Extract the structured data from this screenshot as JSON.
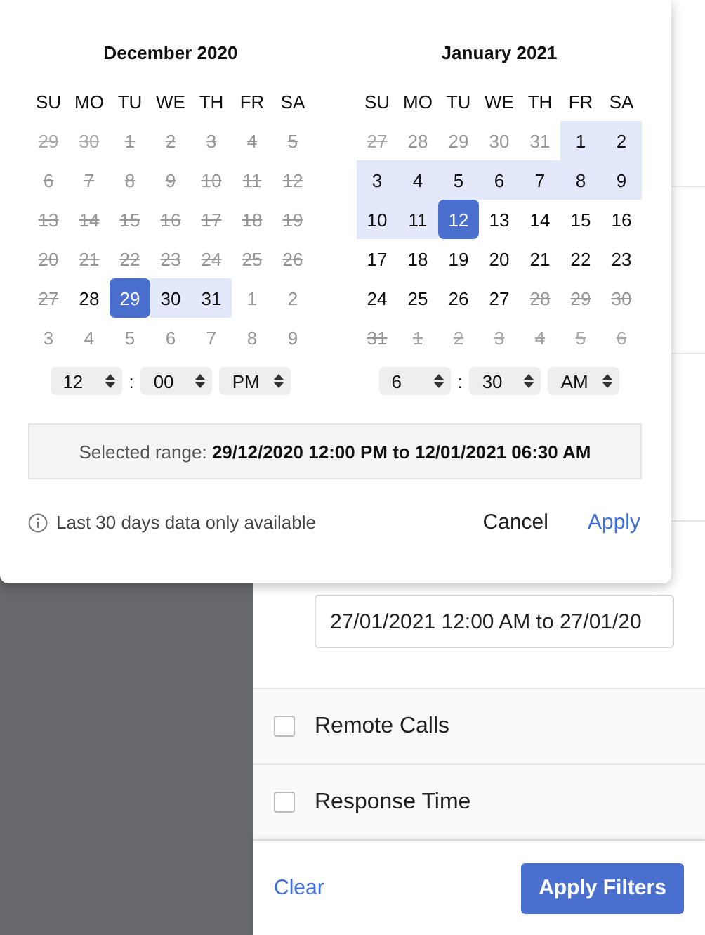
{
  "popup": {
    "months": [
      {
        "title": "December 2020",
        "weekdays": [
          "SU",
          "MO",
          "TU",
          "WE",
          "TH",
          "FR",
          "SA"
        ],
        "weeks": [
          [
            {
              "d": "29",
              "disabled": true,
              "outside": true,
              "in_range": false,
              "selected": false
            },
            {
              "d": "30",
              "disabled": true,
              "outside": true,
              "in_range": false,
              "selected": false
            },
            {
              "d": "1",
              "disabled": true,
              "outside": false,
              "in_range": false,
              "selected": false
            },
            {
              "d": "2",
              "disabled": true,
              "outside": false,
              "in_range": false,
              "selected": false
            },
            {
              "d": "3",
              "disabled": true,
              "outside": false,
              "in_range": false,
              "selected": false
            },
            {
              "d": "4",
              "disabled": true,
              "outside": false,
              "in_range": false,
              "selected": false
            },
            {
              "d": "5",
              "disabled": true,
              "outside": false,
              "in_range": false,
              "selected": false
            }
          ],
          [
            {
              "d": "6",
              "disabled": true,
              "outside": false,
              "in_range": false,
              "selected": false
            },
            {
              "d": "7",
              "disabled": true,
              "outside": false,
              "in_range": false,
              "selected": false
            },
            {
              "d": "8",
              "disabled": true,
              "outside": false,
              "in_range": false,
              "selected": false
            },
            {
              "d": "9",
              "disabled": true,
              "outside": false,
              "in_range": false,
              "selected": false
            },
            {
              "d": "10",
              "disabled": true,
              "outside": false,
              "in_range": false,
              "selected": false
            },
            {
              "d": "11",
              "disabled": true,
              "outside": false,
              "in_range": false,
              "selected": false
            },
            {
              "d": "12",
              "disabled": true,
              "outside": false,
              "in_range": false,
              "selected": false
            }
          ],
          [
            {
              "d": "13",
              "disabled": true,
              "outside": false,
              "in_range": false,
              "selected": false
            },
            {
              "d": "14",
              "disabled": true,
              "outside": false,
              "in_range": false,
              "selected": false
            },
            {
              "d": "15",
              "disabled": true,
              "outside": false,
              "in_range": false,
              "selected": false
            },
            {
              "d": "16",
              "disabled": true,
              "outside": false,
              "in_range": false,
              "selected": false
            },
            {
              "d": "17",
              "disabled": true,
              "outside": false,
              "in_range": false,
              "selected": false
            },
            {
              "d": "18",
              "disabled": true,
              "outside": false,
              "in_range": false,
              "selected": false
            },
            {
              "d": "19",
              "disabled": true,
              "outside": false,
              "in_range": false,
              "selected": false
            }
          ],
          [
            {
              "d": "20",
              "disabled": true,
              "outside": false,
              "in_range": false,
              "selected": false
            },
            {
              "d": "21",
              "disabled": true,
              "outside": false,
              "in_range": false,
              "selected": false
            },
            {
              "d": "22",
              "disabled": true,
              "outside": false,
              "in_range": false,
              "selected": false
            },
            {
              "d": "23",
              "disabled": true,
              "outside": false,
              "in_range": false,
              "selected": false
            },
            {
              "d": "24",
              "disabled": true,
              "outside": false,
              "in_range": false,
              "selected": false
            },
            {
              "d": "25",
              "disabled": true,
              "outside": false,
              "in_range": false,
              "selected": false
            },
            {
              "d": "26",
              "disabled": true,
              "outside": false,
              "in_range": false,
              "selected": false
            }
          ],
          [
            {
              "d": "27",
              "disabled": true,
              "outside": false,
              "in_range": false,
              "selected": false
            },
            {
              "d": "28",
              "disabled": false,
              "outside": false,
              "in_range": false,
              "selected": false
            },
            {
              "d": "29",
              "disabled": false,
              "outside": false,
              "in_range": false,
              "selected": true
            },
            {
              "d": "30",
              "disabled": false,
              "outside": false,
              "in_range": true,
              "selected": false
            },
            {
              "d": "31",
              "disabled": false,
              "outside": false,
              "in_range": true,
              "selected": false
            },
            {
              "d": "1",
              "disabled": false,
              "outside": true,
              "in_range": false,
              "selected": false
            },
            {
              "d": "2",
              "disabled": false,
              "outside": true,
              "in_range": false,
              "selected": false
            }
          ],
          [
            {
              "d": "3",
              "disabled": false,
              "outside": true,
              "in_range": false,
              "selected": false
            },
            {
              "d": "4",
              "disabled": false,
              "outside": true,
              "in_range": false,
              "selected": false
            },
            {
              "d": "5",
              "disabled": false,
              "outside": true,
              "in_range": false,
              "selected": false
            },
            {
              "d": "6",
              "disabled": false,
              "outside": true,
              "in_range": false,
              "selected": false
            },
            {
              "d": "7",
              "disabled": false,
              "outside": true,
              "in_range": false,
              "selected": false
            },
            {
              "d": "8",
              "disabled": false,
              "outside": true,
              "in_range": false,
              "selected": false
            },
            {
              "d": "9",
              "disabled": false,
              "outside": true,
              "in_range": false,
              "selected": false
            }
          ]
        ],
        "time": {
          "hour": "12",
          "separator": ":",
          "minute": "00",
          "meridiem": "PM"
        }
      },
      {
        "title": "January 2021",
        "weekdays": [
          "SU",
          "MO",
          "TU",
          "WE",
          "TH",
          "FR",
          "SA"
        ],
        "weeks": [
          [
            {
              "d": "27",
              "disabled": true,
              "outside": true,
              "in_range": false,
              "selected": false
            },
            {
              "d": "28",
              "disabled": false,
              "outside": true,
              "in_range": false,
              "selected": false
            },
            {
              "d": "29",
              "disabled": false,
              "outside": true,
              "in_range": false,
              "selected": false
            },
            {
              "d": "30",
              "disabled": false,
              "outside": true,
              "in_range": false,
              "selected": false
            },
            {
              "d": "31",
              "disabled": false,
              "outside": true,
              "in_range": false,
              "selected": false
            },
            {
              "d": "1",
              "disabled": false,
              "outside": false,
              "in_range": true,
              "selected": false
            },
            {
              "d": "2",
              "disabled": false,
              "outside": false,
              "in_range": true,
              "selected": false
            }
          ],
          [
            {
              "d": "3",
              "disabled": false,
              "outside": false,
              "in_range": true,
              "selected": false
            },
            {
              "d": "4",
              "disabled": false,
              "outside": false,
              "in_range": true,
              "selected": false
            },
            {
              "d": "5",
              "disabled": false,
              "outside": false,
              "in_range": true,
              "selected": false
            },
            {
              "d": "6",
              "disabled": false,
              "outside": false,
              "in_range": true,
              "selected": false
            },
            {
              "d": "7",
              "disabled": false,
              "outside": false,
              "in_range": true,
              "selected": false
            },
            {
              "d": "8",
              "disabled": false,
              "outside": false,
              "in_range": true,
              "selected": false
            },
            {
              "d": "9",
              "disabled": false,
              "outside": false,
              "in_range": true,
              "selected": false
            }
          ],
          [
            {
              "d": "10",
              "disabled": false,
              "outside": false,
              "in_range": true,
              "selected": false
            },
            {
              "d": "11",
              "disabled": false,
              "outside": false,
              "in_range": true,
              "selected": false
            },
            {
              "d": "12",
              "disabled": false,
              "outside": false,
              "in_range": false,
              "selected": true
            },
            {
              "d": "13",
              "disabled": false,
              "outside": false,
              "in_range": false,
              "selected": false
            },
            {
              "d": "14",
              "disabled": false,
              "outside": false,
              "in_range": false,
              "selected": false
            },
            {
              "d": "15",
              "disabled": false,
              "outside": false,
              "in_range": false,
              "selected": false
            },
            {
              "d": "16",
              "disabled": false,
              "outside": false,
              "in_range": false,
              "selected": false
            }
          ],
          [
            {
              "d": "17",
              "disabled": false,
              "outside": false,
              "in_range": false,
              "selected": false
            },
            {
              "d": "18",
              "disabled": false,
              "outside": false,
              "in_range": false,
              "selected": false
            },
            {
              "d": "19",
              "disabled": false,
              "outside": false,
              "in_range": false,
              "selected": false
            },
            {
              "d": "20",
              "disabled": false,
              "outside": false,
              "in_range": false,
              "selected": false
            },
            {
              "d": "21",
              "disabled": false,
              "outside": false,
              "in_range": false,
              "selected": false
            },
            {
              "d": "22",
              "disabled": false,
              "outside": false,
              "in_range": false,
              "selected": false
            },
            {
              "d": "23",
              "disabled": false,
              "outside": false,
              "in_range": false,
              "selected": false
            }
          ],
          [
            {
              "d": "24",
              "disabled": false,
              "outside": false,
              "in_range": false,
              "selected": false
            },
            {
              "d": "25",
              "disabled": false,
              "outside": false,
              "in_range": false,
              "selected": false
            },
            {
              "d": "26",
              "disabled": false,
              "outside": false,
              "in_range": false,
              "selected": false
            },
            {
              "d": "27",
              "disabled": false,
              "outside": false,
              "in_range": false,
              "selected": false
            },
            {
              "d": "28",
              "disabled": true,
              "outside": false,
              "in_range": false,
              "selected": false
            },
            {
              "d": "29",
              "disabled": true,
              "outside": false,
              "in_range": false,
              "selected": false
            },
            {
              "d": "30",
              "disabled": true,
              "outside": false,
              "in_range": false,
              "selected": false
            }
          ],
          [
            {
              "d": "31",
              "disabled": true,
              "outside": false,
              "in_range": false,
              "selected": false
            },
            {
              "d": "1",
              "disabled": true,
              "outside": true,
              "in_range": false,
              "selected": false
            },
            {
              "d": "2",
              "disabled": true,
              "outside": true,
              "in_range": false,
              "selected": false
            },
            {
              "d": "3",
              "disabled": true,
              "outside": true,
              "in_range": false,
              "selected": false
            },
            {
              "d": "4",
              "disabled": true,
              "outside": true,
              "in_range": false,
              "selected": false
            },
            {
              "d": "5",
              "disabled": true,
              "outside": true,
              "in_range": false,
              "selected": false
            },
            {
              "d": "6",
              "disabled": true,
              "outside": true,
              "in_range": false,
              "selected": false
            }
          ]
        ],
        "time": {
          "hour": "6",
          "separator": ":",
          "minute": "30",
          "meridiem": "AM"
        }
      }
    ],
    "selected_range": "Selected range: **29/12/2020 12:00 PM to 12/01/2021 06:30 AM**",
    "note": "Last 30 days data only available",
    "buttons": [
      {
        "label": "Cancel",
        "kind": "secondary"
      },
      {
        "label": "Apply",
        "kind": "primary"
      }
    ]
  },
  "filter_panel": {
    "date_field": {
      "value": "27/01/2021 12:00 AM to 27/01/20"
    },
    "options": [
      {
        "label": "Remote Calls",
        "checked": false
      },
      {
        "label": "Response Time",
        "checked": false
      }
    ],
    "clear": "Clear",
    "apply": "Apply Filters"
  }
}
